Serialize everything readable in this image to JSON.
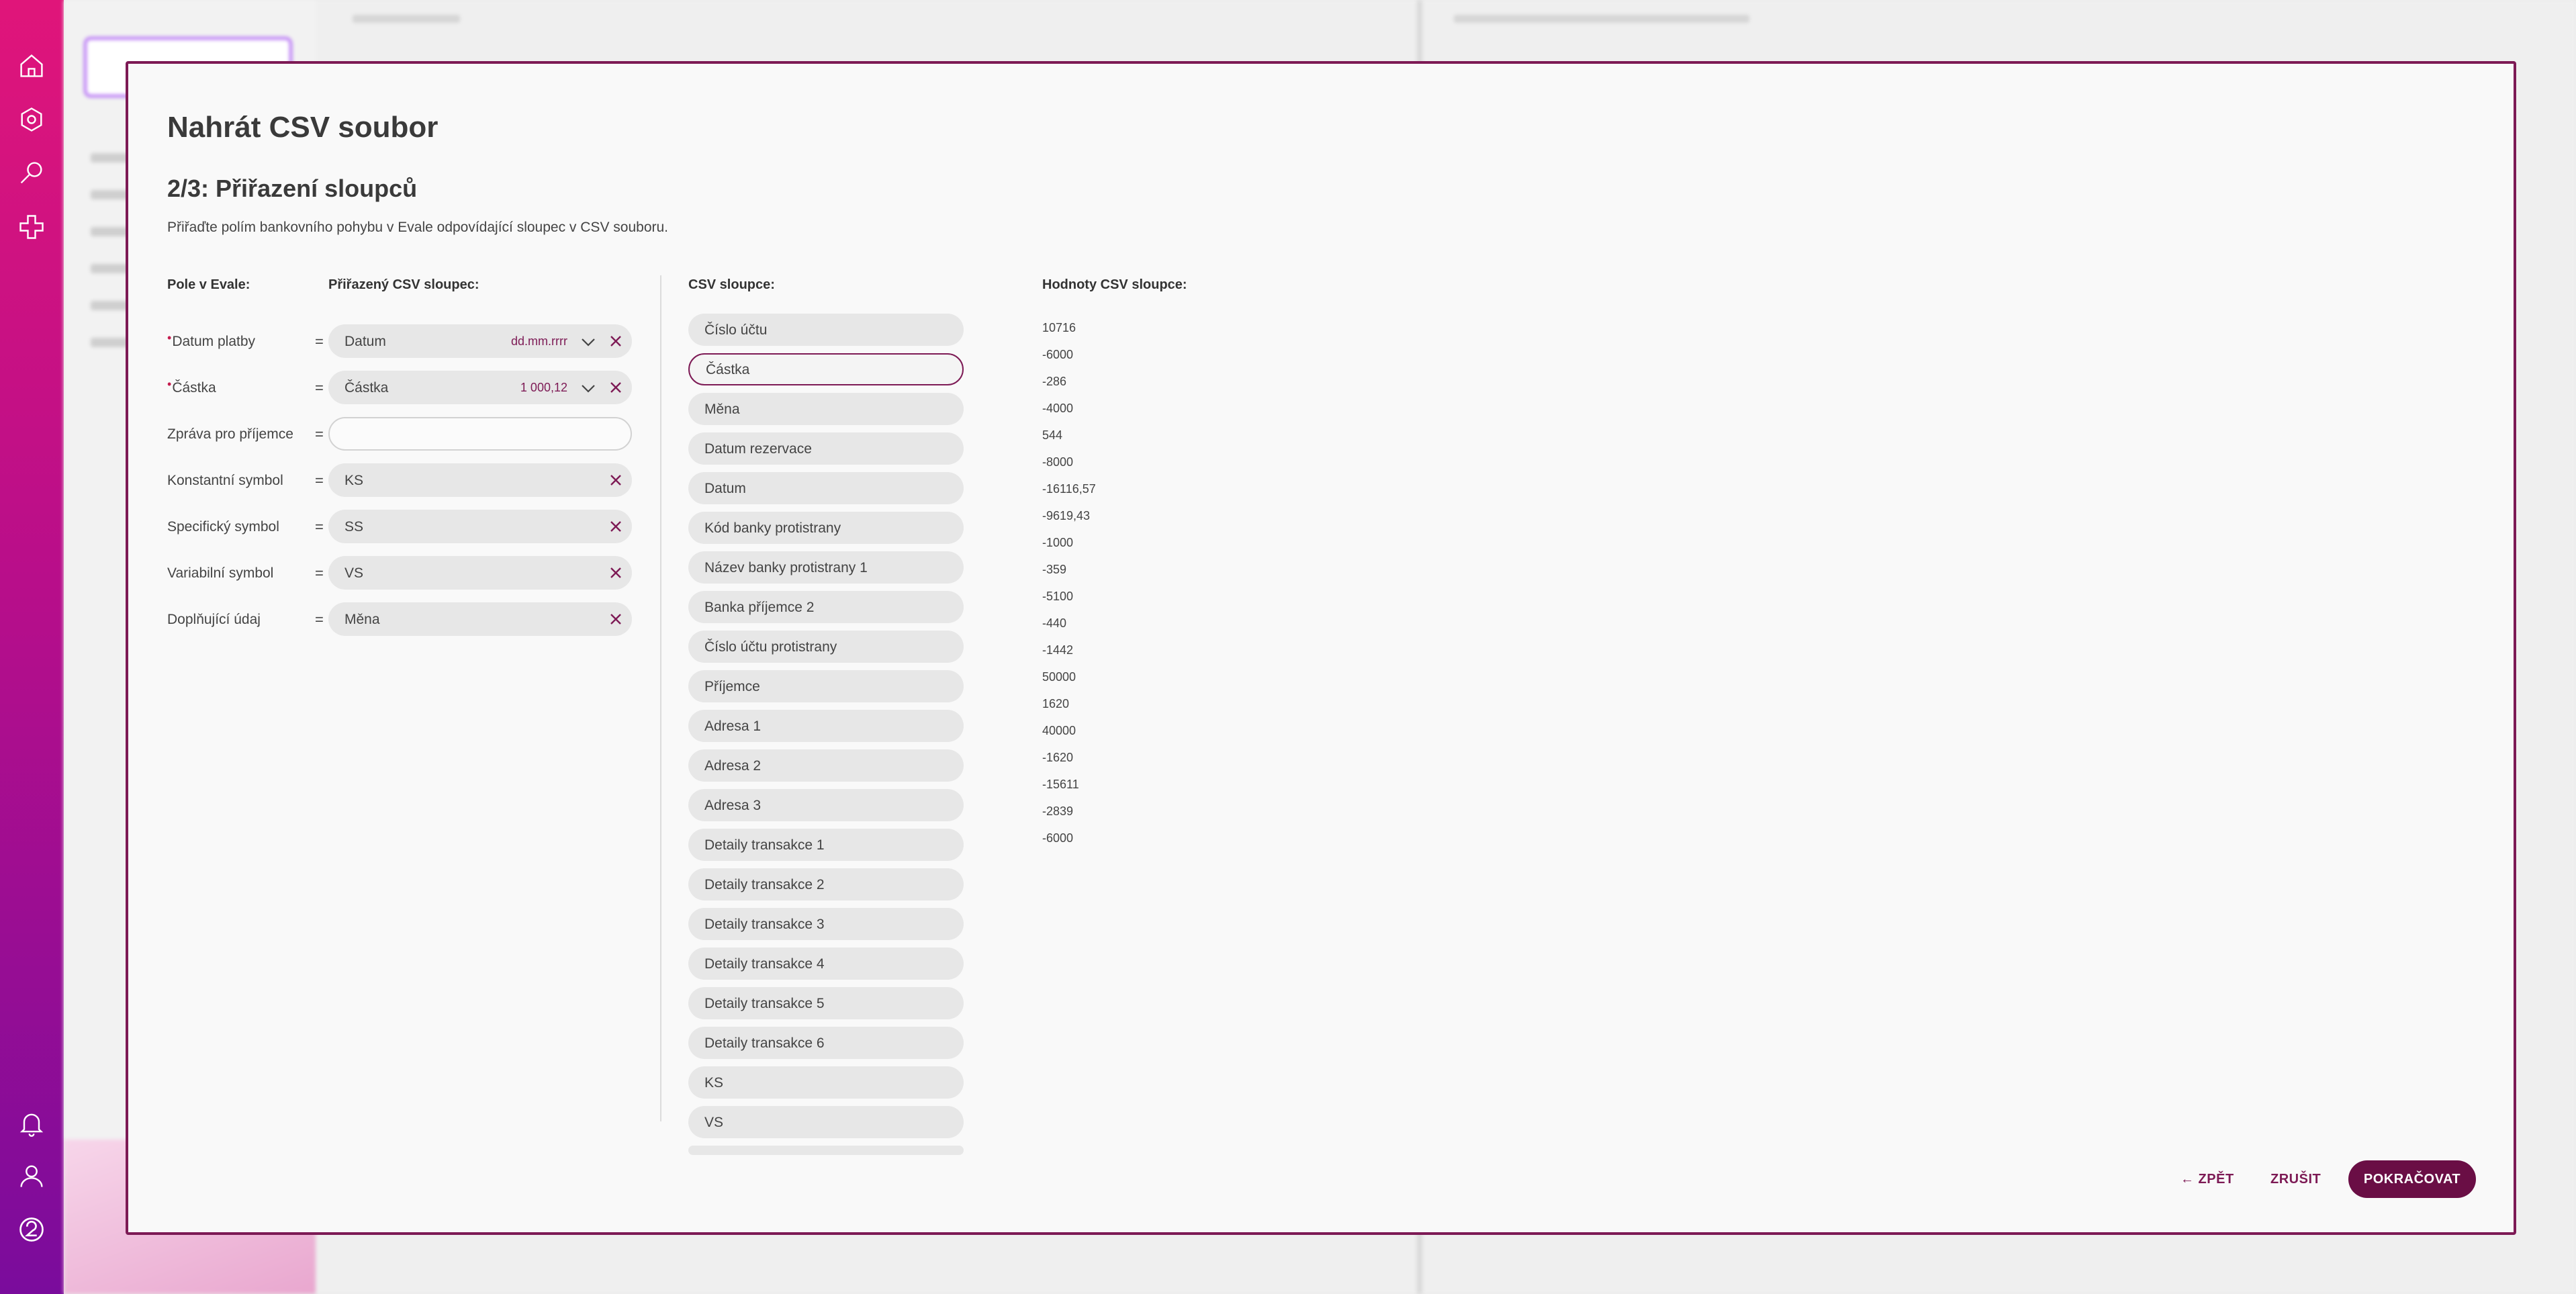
{
  "modal": {
    "title": "Nahrát CSV soubor",
    "step_title": "2/3: Přiřazení sloupců",
    "instructions": "Přiřaďte polím bankovního pohybu v Evale odpovídající sloupec v CSV souboru.",
    "headers": {
      "field": "Pole v Evale:",
      "assigned": "Přiřazený CSV sloupec:",
      "csv_columns": "CSV sloupce:",
      "csv_values": "Hodnoty CSV sloupce:"
    },
    "fields": [
      {
        "label": "Datum platby",
        "required": true,
        "value": "Datum",
        "format": "dd.mm.rrrr",
        "has_dropdown": true,
        "has_clear": true
      },
      {
        "label": "Částka",
        "required": true,
        "value": "Částka",
        "format": "1 000,12",
        "has_dropdown": true,
        "has_clear": true
      },
      {
        "label": "Zpráva pro příjemce",
        "required": false,
        "value": "",
        "format": "",
        "has_dropdown": false,
        "has_clear": false
      },
      {
        "label": "Konstantní symbol",
        "required": false,
        "value": "KS",
        "format": "",
        "has_dropdown": false,
        "has_clear": true
      },
      {
        "label": "Specifický symbol",
        "required": false,
        "value": "SS",
        "format": "",
        "has_dropdown": false,
        "has_clear": true
      },
      {
        "label": "Variabilní symbol",
        "required": false,
        "value": "VS",
        "format": "",
        "has_dropdown": false,
        "has_clear": true
      },
      {
        "label": "Doplňující údaj",
        "required": false,
        "value": "Měna",
        "format": "",
        "has_dropdown": false,
        "has_clear": true
      }
    ],
    "equals_sign": "=",
    "required_marker": "•",
    "csv_columns": [
      "Číslo účtu",
      "Částka",
      "Měna",
      "Datum rezervace",
      "Datum",
      "Kód banky protistrany",
      "Název banky protistrany 1",
      "Banka příjemce 2",
      "Číslo účtu protistrany",
      "Příjemce",
      "Adresa 1",
      "Adresa 2",
      "Adresa 3",
      "Detaily transakce 1",
      "Detaily transakce 2",
      "Detaily transakce 3",
      "Detaily transakce 4",
      "Detaily transakce 5",
      "Detaily transakce 6",
      "KS",
      "VS"
    ],
    "selected_csv_column": "Částka",
    "csv_values": [
      "10716",
      "-6000",
      "-286",
      "-4000",
      "544",
      "-8000",
      "-16116,57",
      "-9619,43",
      "-1000",
      "-359",
      "-5100",
      "-440",
      "-1442",
      "50000",
      "1620",
      "40000",
      "-1620",
      "-15611",
      "-2839",
      "-6000"
    ],
    "buttons": {
      "back": "← ZPĚT",
      "cancel": "ZRUŠIT",
      "continue": "POKRAČOVAT"
    }
  },
  "rail": {
    "icons": [
      "home-icon",
      "settings-icon",
      "search-icon",
      "add-icon",
      "bell-icon",
      "user-icon",
      "help-icon"
    ]
  },
  "colors": {
    "accent": "#7d1a55",
    "primary_button": "#6a0e45",
    "required": "#c41c4e",
    "rail_top": "#e0157a",
    "rail_bottom": "#7a0c9c"
  }
}
